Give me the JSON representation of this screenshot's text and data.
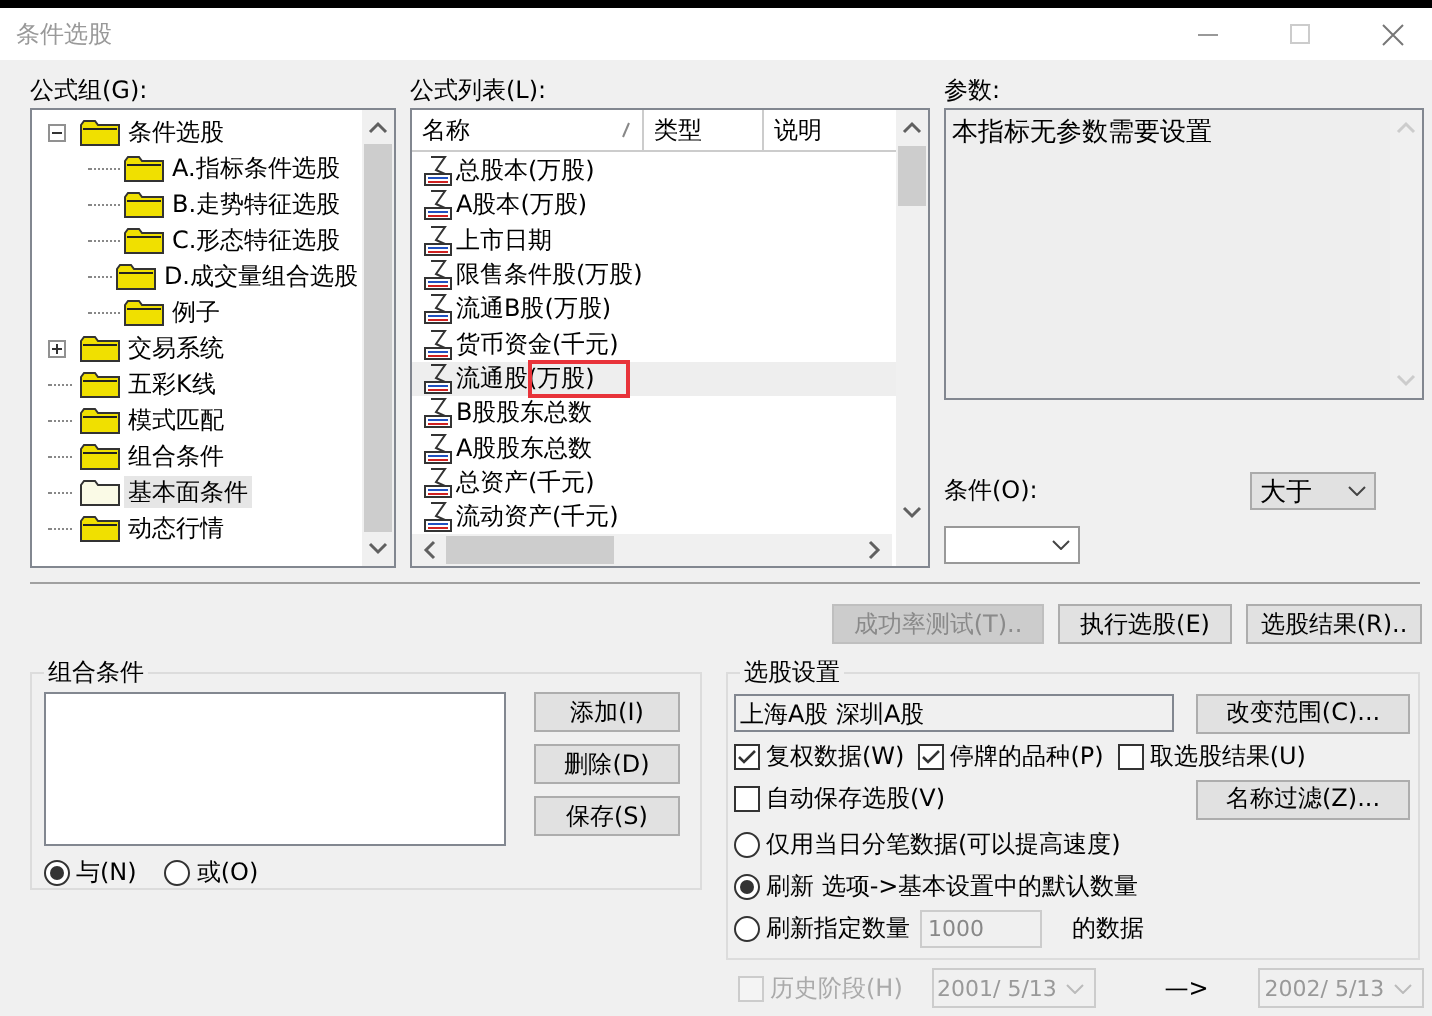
{
  "window": {
    "title": "条件选股"
  },
  "formula_group": {
    "label": "公式组(G):",
    "tree": [
      {
        "label": "条件选股",
        "kind": "branch",
        "expanded": true,
        "selected": false,
        "children": [
          {
            "label": "A.指标条件选股",
            "kind": "leaf",
            "selected": false
          },
          {
            "label": "B.走势特征选股",
            "kind": "leaf",
            "selected": false
          },
          {
            "label": "C.形态特征选股",
            "kind": "leaf",
            "selected": false
          },
          {
            "label": "D.成交量组合选股",
            "kind": "leaf",
            "selected": false
          },
          {
            "label": "例子",
            "kind": "leaf",
            "selected": false
          }
        ]
      },
      {
        "label": "交易系统",
        "kind": "branch",
        "expanded": false,
        "selected": false
      },
      {
        "label": "五彩K线",
        "kind": "leaf",
        "selected": false
      },
      {
        "label": "模式匹配",
        "kind": "leaf",
        "selected": false
      },
      {
        "label": "组合条件",
        "kind": "leaf",
        "selected": false
      },
      {
        "label": "基本面条件",
        "kind": "leaf",
        "selected": true
      },
      {
        "label": "动态行情",
        "kind": "leaf",
        "selected": false
      }
    ]
  },
  "formula_list": {
    "label": "公式列表(L):",
    "columns": [
      "名称",
      "类型",
      "说明"
    ],
    "rows": [
      {
        "name": "总股本(万股)",
        "selected": false
      },
      {
        "name": "A股本(万股)",
        "selected": false
      },
      {
        "name": "上市日期",
        "selected": false
      },
      {
        "name": "限售条件股(万股)",
        "selected": false
      },
      {
        "name": "流通B股(万股)",
        "selected": false
      },
      {
        "name": "货币资金(千元)",
        "selected": false
      },
      {
        "name": "流通股(万股)",
        "selected": true
      },
      {
        "name": "B股股东总数",
        "selected": false
      },
      {
        "name": "A股股东总数",
        "selected": false
      },
      {
        "name": "总资产(千元)",
        "selected": false
      },
      {
        "name": "流动资产(千元)",
        "selected": false
      }
    ]
  },
  "parameters": {
    "label": "参数:",
    "text": "本指标无参数需要设置"
  },
  "condition": {
    "label": "条件(O):",
    "operator": "大于"
  },
  "action_buttons": [
    {
      "label": "成功率测试(T)..",
      "disabled": true
    },
    {
      "label": "执行选股(E)",
      "disabled": false
    },
    {
      "label": "选股结果(R)..",
      "disabled": false
    }
  ],
  "combination": {
    "title": "组合条件",
    "buttons": [
      "添加(I)",
      "删除(D)",
      "保存(S)"
    ],
    "radios": [
      {
        "label": "与(N)",
        "selected": true
      },
      {
        "label": "或(O)",
        "selected": false
      }
    ]
  },
  "stock_settings": {
    "title": "选股设置",
    "range": "上海A股  深圳A股",
    "range_button": "改变范围(C)...",
    "checkboxes": [
      {
        "label": "复权数据(W)",
        "checked": true
      },
      {
        "label": "停牌的品种(P)",
        "checked": true
      },
      {
        "label": "取选股结果(U)",
        "checked": false
      }
    ],
    "auto_save": {
      "label": "自动保存选股(V)",
      "checked": false
    },
    "filter_button": "名称过滤(Z)...",
    "radios": [
      {
        "kind": "plain",
        "label": "仅用当日分笔数据(可以提高速度)",
        "selected": false
      },
      {
        "kind": "plain",
        "label": "刷新 选项->基本设置中的默认数量",
        "selected": true
      },
      {
        "kind": "count",
        "label": "刷新指定数量",
        "value": "1000",
        "suffix": "的数据",
        "selected": false
      }
    ]
  },
  "history": {
    "label": "历史阶段(H)",
    "checked": false,
    "disabled": true,
    "from": "2001/ 5/13",
    "arrow": "—>",
    "to": "2002/ 5/13"
  }
}
